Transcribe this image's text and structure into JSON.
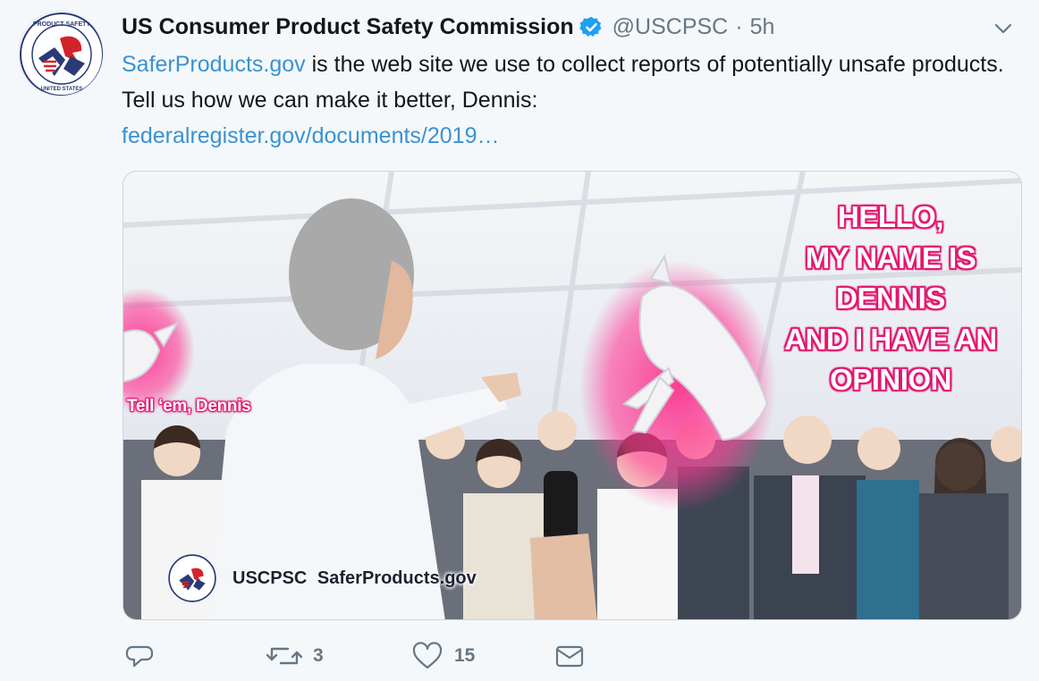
{
  "tweet": {
    "author_name": "US Consumer Product Safety Commission",
    "handle": "@USCPSC",
    "separator": "·",
    "time": "5h",
    "verified": true,
    "text_link": "SaferProducts.gov",
    "text_body": " is the web site we use to collect reports of potentially unsafe products. Tell us how we can make it better, Dennis:",
    "url": "federalregister.gov/documents/2019…"
  },
  "media": {
    "headline": [
      "HELLO,",
      "MY NAME IS",
      "DENNIS",
      "AND I HAVE AN",
      "OPINION"
    ],
    "caption": "Tell ‘em, Dennis",
    "brand_handle": "USCPSC",
    "brand_site": "SaferProducts.gov"
  },
  "actions": {
    "reply_icon": "reply-icon",
    "retweet_icon": "retweet-icon",
    "retweet_count": "3",
    "like_icon": "heart-icon",
    "like_count": "15",
    "dm_icon": "envelope-icon"
  },
  "colors": {
    "link": "#3a92d2",
    "verified": "#1da1f2",
    "muted": "#657786",
    "glow": "#e2166f"
  }
}
